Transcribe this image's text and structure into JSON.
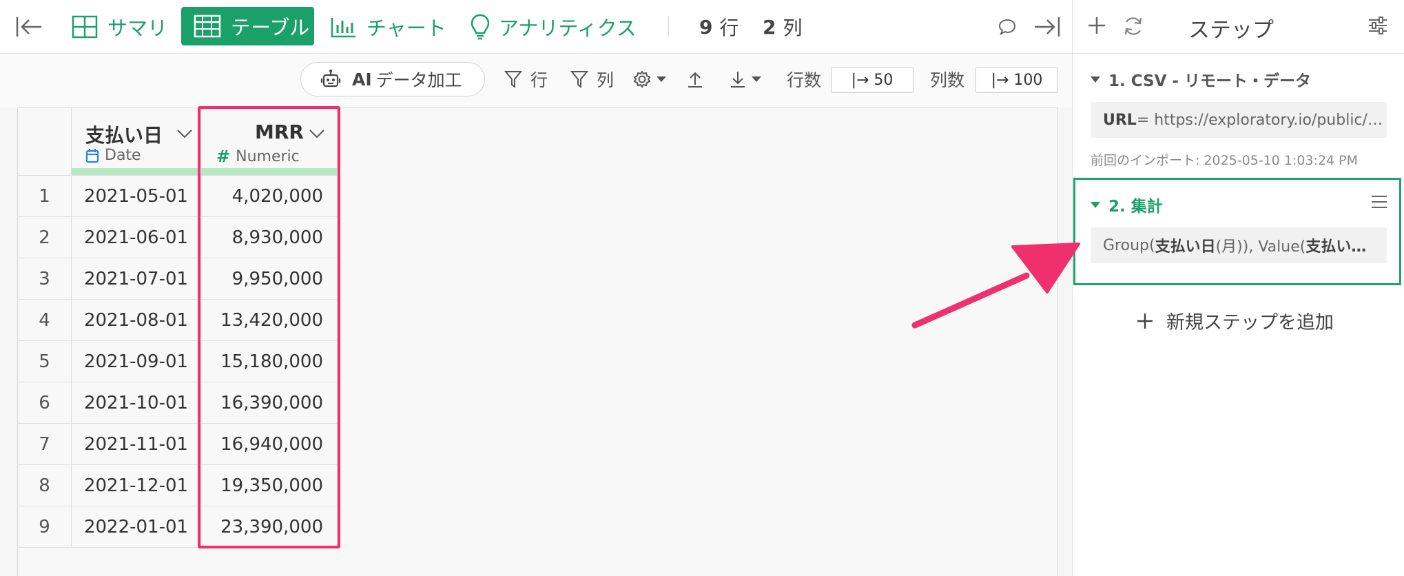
{
  "toolbar": {
    "tabs": [
      {
        "label": "サマリ"
      },
      {
        "label": "テーブル"
      },
      {
        "label": "チャート"
      },
      {
        "label": "アナリティクス"
      }
    ],
    "row_count": "9",
    "row_unit": "行",
    "col_count": "2",
    "col_unit": "列"
  },
  "subbar": {
    "ai_label": "AI",
    "ai_text": "データ加工",
    "filter_row": "行",
    "filter_col": "列",
    "rows_label": "行数",
    "rows_value": "|→ 50",
    "cols_label": "列数",
    "cols_value": "|→ 100"
  },
  "table": {
    "columns": [
      {
        "name": "支払い日",
        "type": "Date"
      },
      {
        "name": "MRR",
        "type": "Numeric"
      }
    ],
    "rows": [
      {
        "n": "1",
        "date": "2021-05-01",
        "mrr": "4,020,000"
      },
      {
        "n": "2",
        "date": "2021-06-01",
        "mrr": "8,930,000"
      },
      {
        "n": "3",
        "date": "2021-07-01",
        "mrr": "9,950,000"
      },
      {
        "n": "4",
        "date": "2021-08-01",
        "mrr": "13,420,000"
      },
      {
        "n": "5",
        "date": "2021-09-01",
        "mrr": "15,180,000"
      },
      {
        "n": "6",
        "date": "2021-10-01",
        "mrr": "16,390,000"
      },
      {
        "n": "7",
        "date": "2021-11-01",
        "mrr": "16,940,000"
      },
      {
        "n": "8",
        "date": "2021-12-01",
        "mrr": "19,350,000"
      },
      {
        "n": "9",
        "date": "2022-01-01",
        "mrr": "23,390,000"
      }
    ]
  },
  "panel": {
    "title": "ステップ",
    "step1": {
      "title": "1. CSV - リモート・データ",
      "key": "URL",
      "value": " = https://exploratory.io/public/…",
      "meta": "前回のインポート: 2025-05-10 1:03:24 PM"
    },
    "step2": {
      "title": "2. 集計",
      "p1": "Group(",
      "b1": "支払い日",
      "p2": " (月)), Value(",
      "b2": "支払い…"
    },
    "add_step": "新規ステップを追加"
  },
  "colors": {
    "accent": "#1ca06a",
    "highlight": "#f0306e",
    "type_bar": "#b6e8c2"
  }
}
